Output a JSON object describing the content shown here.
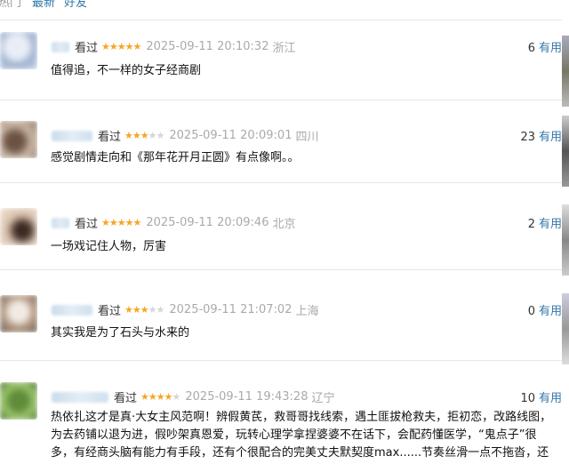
{
  "sort_bar": {
    "label": "热门",
    "options": [
      "最新",
      "好友"
    ]
  },
  "useful_label": "有用",
  "watched_label": "看过",
  "reviews": [
    {
      "stars": 5,
      "time": "2025-09-11 20:10:32",
      "location": "浙江",
      "votes": "6",
      "content": "值得追，不一样的女子经商剧"
    },
    {
      "stars": 3,
      "time": "2025-09-11 20:09:01",
      "location": "四川",
      "votes": "23",
      "content": "感觉剧情走向和《那年花开月正圆》有点像啊。。"
    },
    {
      "stars": 5,
      "time": "2025-09-11 20:09:46",
      "location": "北京",
      "votes": "2",
      "content": "一场戏记住人物，厉害"
    },
    {
      "stars": 3,
      "time": "2025-09-11 21:07:02",
      "location": "上海",
      "votes": "0",
      "content": "其实我是为了石头与水来的"
    },
    {
      "stars": 4,
      "time": "2025-09-11 19:43:28",
      "location": "辽宁",
      "votes": "10",
      "content": "热依扎这才是真·大女主风范啊！辨假黄芪，救哥哥找线索，遇土匪拔枪救夫，拒初恋，改路线图，为去药铺以退为进，假吵架真恩爱，玩转心理学拿捏婆婆不在话下，会配药懂医学，“鬼点子”很多，有经商头脑有能力有手段，还有个很配合的完美丈夫默契度max......节奏丝滑一点不拖沓，还是..."
    }
  ]
}
